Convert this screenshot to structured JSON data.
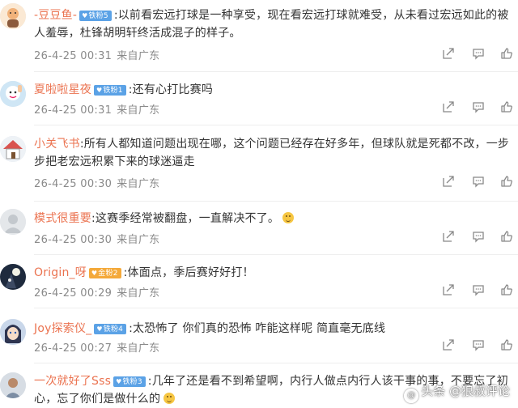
{
  "comments": [
    {
      "username": "-豆豆鱼-",
      "badge": "铁粉5",
      "badge_type": "blue",
      "text": ":以前看宏远打球是一种享受，现在看宏远打球就难受，从未看过宏远如此的被人羞辱，杜锋胡明轩终活成混子的样子。",
      "date": "26-4-25 00:31",
      "location": "来自广东",
      "avatar_icon": "avatar-cartoon-icon"
    },
    {
      "username": "夏啦啦星夜",
      "badge": "铁粉1",
      "badge_type": "blue",
      "text": ":还有心打比赛吗",
      "date": "26-4-25 00:31",
      "location": "来自广东",
      "avatar_icon": "avatar-gesture-icon"
    },
    {
      "username": "小关飞书",
      "badge": "",
      "badge_type": "",
      "text": ":所有人都知道问题出现在哪，这个问题已经存在好多年，但球队就是死都不改，一步步把老宏远积累下来的球迷逼走",
      "date": "26-4-25 00:30",
      "location": "来自广东",
      "avatar_icon": "avatar-house-icon"
    },
    {
      "username": "模式很重要",
      "badge": "",
      "badge_type": "",
      "text": ":这赛季经常被翻盘，一直解决不了。",
      "date": "26-4-25 00:30",
      "location": "来自广东",
      "avatar_icon": "avatar-default-icon"
    },
    {
      "username": "Origin_呀",
      "badge": "金粉2",
      "badge_type": "gold",
      "text": ":体面点，季后赛好好打！",
      "date": "26-4-25 00:29",
      "location": "来自广东",
      "avatar_icon": "avatar-moon-icon"
    },
    {
      "username": "Joy探索仪_",
      "badge": "铁粉4",
      "badge_type": "blue",
      "text": ":太恐怖了 你们真的恐怖 咋能这样呢 简直毫无底线",
      "date": "26-4-25 00:27",
      "location": "来自广东",
      "avatar_icon": "avatar-anime-icon"
    },
    {
      "username": "一次就好了Sss",
      "badge": "铁粉3",
      "badge_type": "blue",
      "text": ":几年了还是看不到希望啊，内行人做点内行人该干事的事，不要忘了初心，忘了你们是做什么的",
      "date": "",
      "location": "",
      "avatar_icon": "avatar-person-icon"
    }
  ],
  "watermark": "头条 @狼叔评论",
  "colors": {
    "username": "#eb7350",
    "meta": "#8a8a8a",
    "badge_blue": "#5ba2e6",
    "badge_gold": "#f4a93a"
  }
}
